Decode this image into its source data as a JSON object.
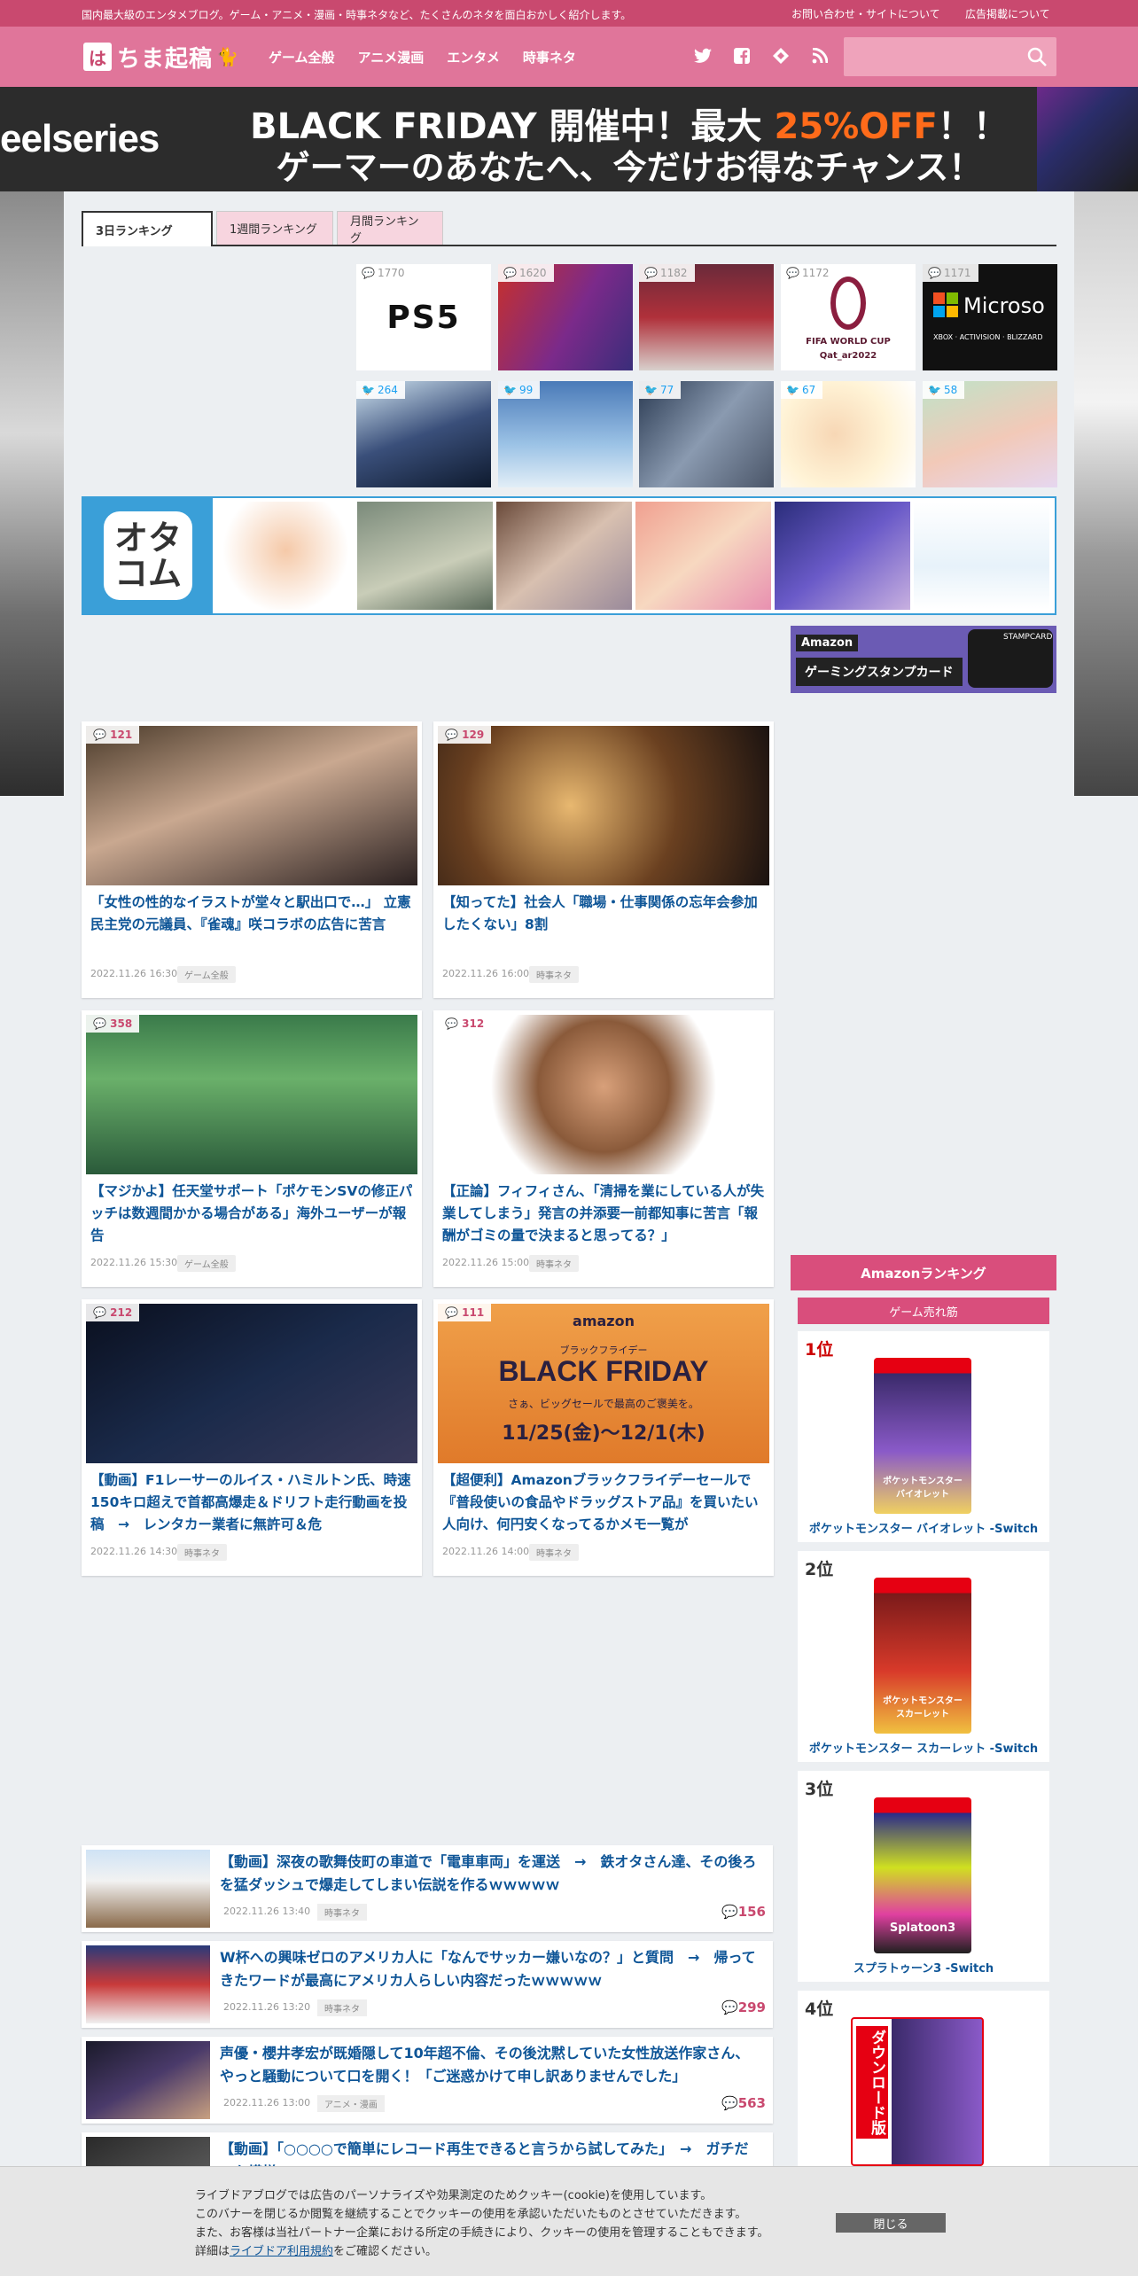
{
  "top_strip": {
    "tagline": "国内最大級のエンタメブログ。ゲーム・アニメ・漫画・時事ネタなど、たくさんのネタを面白おかしく紹介します。",
    "links": [
      "お問い合わせ・サイトについて",
      "広告掲載について"
    ]
  },
  "header": {
    "logo_mark": "は",
    "logo_text": "ちま起稿",
    "nav": [
      "ゲーム全般",
      "アニメ漫画",
      "エンタメ",
      "時事ネタ"
    ],
    "social_icons": [
      "twitter-icon",
      "facebook-icon",
      "feedly-icon",
      "rss-icon"
    ],
    "search_placeholder": ""
  },
  "banner": {
    "brand": "eelseries",
    "line1_a": "BLACK FRIDAY 開催中！最大 ",
    "line1_hl": "25%OFF",
    "line1_b": "！！",
    "line2": "ゲーマーのあなたへ、今だけお得なチャンス！",
    "highlight_color": "#ff6b1a"
  },
  "ranking": {
    "tabs": [
      "3日ランキング",
      "1週間ランキング",
      "月間ランキング"
    ],
    "active_tab": 0,
    "comment_ranks": [
      "1770",
      "1620",
      "1182",
      "1172",
      "1171"
    ],
    "tweet_ranks": [
      "264",
      "99",
      "77",
      "67",
      "58"
    ],
    "thumb_text": {
      "ps5": "PS5",
      "wc1": "FIFA WORLD CUP",
      "wc2": "Qat_ar2022",
      "ms": "Microso",
      "ms_sub": "XBOX · ACTIVISION · BLIZZARD"
    }
  },
  "okayu": {
    "logo": "オタ\nコム"
  },
  "amazon_card": {
    "brand": "Amazon",
    "label": "ゲーミングスタンプカード",
    "stamp": "STAMPCARD"
  },
  "cards": [
    {
      "count": "121",
      "title": "「女性の性的なイラストが堂々と駅出口で…」 立憲民主党の元議員、『雀魂』咲コラボの広告に苦言",
      "date": "2022.11.26 16:30",
      "cat": "ゲーム全般"
    },
    {
      "count": "129",
      "title": "【知ってた】社会人「職場・仕事関係の忘年会参加したくない」8割",
      "date": "2022.11.26 16:00",
      "cat": "時事ネタ"
    },
    {
      "count": "358",
      "title": "【マジかよ】任天堂サポート「ポケモンSVの修正パッチは数週間かかる場合がある」海外ユーザーが報告",
      "date": "2022.11.26 15:30",
      "cat": "ゲーム全般"
    },
    {
      "count": "312",
      "title": "【正論】フィフィさん、「清掃を業にしている人が失業してしまう」発言の并添要一前都知事に苦言「報酬がゴミの量で決まると思ってる？」",
      "date": "2022.11.26 15:00",
      "cat": "時事ネタ"
    },
    {
      "count": "212",
      "title": "【動画】F1レーサーのルイス・ハミルトン氏、時速150キロ超えで首都高爆走＆ドリフト走行動画を投稿　→　レンタカー業者に無許可＆危",
      "date": "2022.11.26 14:30",
      "cat": "時事ネタ"
    },
    {
      "count": "111",
      "title": "【超便利】Amazonブラックフライデーセールで『普段使いの食品やドラッグストア品』を買いたい人向け、何円安くなってるかメモ一覧が",
      "date": "2022.11.26 14:00",
      "cat": "時事ネタ"
    }
  ],
  "bf_card_image": {
    "amazon": "amazon",
    "small": "ブラックフライデー",
    "big": "BLACK FRIDAY",
    "sub": "さぁ、ビッグセールで最高のご褒美を。",
    "dates": "11/25(金)〜12/1(木)"
  },
  "list": [
    {
      "title": "【動画】深夜の歌舞伎町の車道で「電車車両」を運送　→　鉄オタさん達、その後ろを猛ダッシュで爆走してしまい伝説を作るｗｗｗｗｗ",
      "date": "2022.11.26 13:40",
      "cat": "時事ネタ",
      "count": "156"
    },
    {
      "title": "W杯への興味ゼロのアメリカ人に「なんでサッカー嫌いなの？」と質問　→　帰ってきたワードが最高にアメリカ人らしい内容だったｗｗｗｗｗ",
      "date": "2022.11.26 13:20",
      "cat": "時事ネタ",
      "count": "299"
    },
    {
      "title": "声優・櫻井孝宏が既婚隠して10年超不倫、その後沈黙していた女性放送作家さん、やっと騒動について口を開く！「ご迷惑かけて申し訳ありませんでした」",
      "date": "2022.11.26 13:00",
      "cat": "アニメ・漫画",
      "count": "563"
    },
    {
      "title": "【動画】「○○○○で簡単にレコード再生できると言うから試してみた」　→　ガチだった模様",
      "date": "",
      "cat": "",
      "count": ""
    }
  ],
  "amazon_ranking": {
    "heading": "Amazonランキング",
    "sub": "ゲーム売れ筋",
    "items": [
      {
        "rank": "1位",
        "name": "ポケットモンスター バイオレット -Switch",
        "box_title": "ポケットモンスター\nバイオレット"
      },
      {
        "rank": "2位",
        "name": "ポケットモンスター スカーレット -Switch",
        "box_title": "ポケットモンスター\nスカーレット"
      },
      {
        "rank": "3位",
        "name": "スプラトゥーン3 -Switch",
        "box_title": "Splatoon3"
      },
      {
        "rank": "4位",
        "name": "",
        "box_title": "ダウンロード版"
      }
    ]
  },
  "cookie": {
    "lines": [
      "ライブドアブログでは広告のパーソナライズや効果測定のためクッキー(cookie)を使用しています。",
      "このバナーを閉じるか閲覧を継続することでクッキーの使用を承認いただいたものとさせていただきます。",
      "また、お客様は当社パートナー企業における所定の手続きにより、クッキーの使用を管理することもできます。"
    ],
    "detail_prefix": "詳細は",
    "detail_link": "ライブドア利用規約",
    "detail_suffix": "をご確認ください。",
    "close": "閉じる"
  }
}
